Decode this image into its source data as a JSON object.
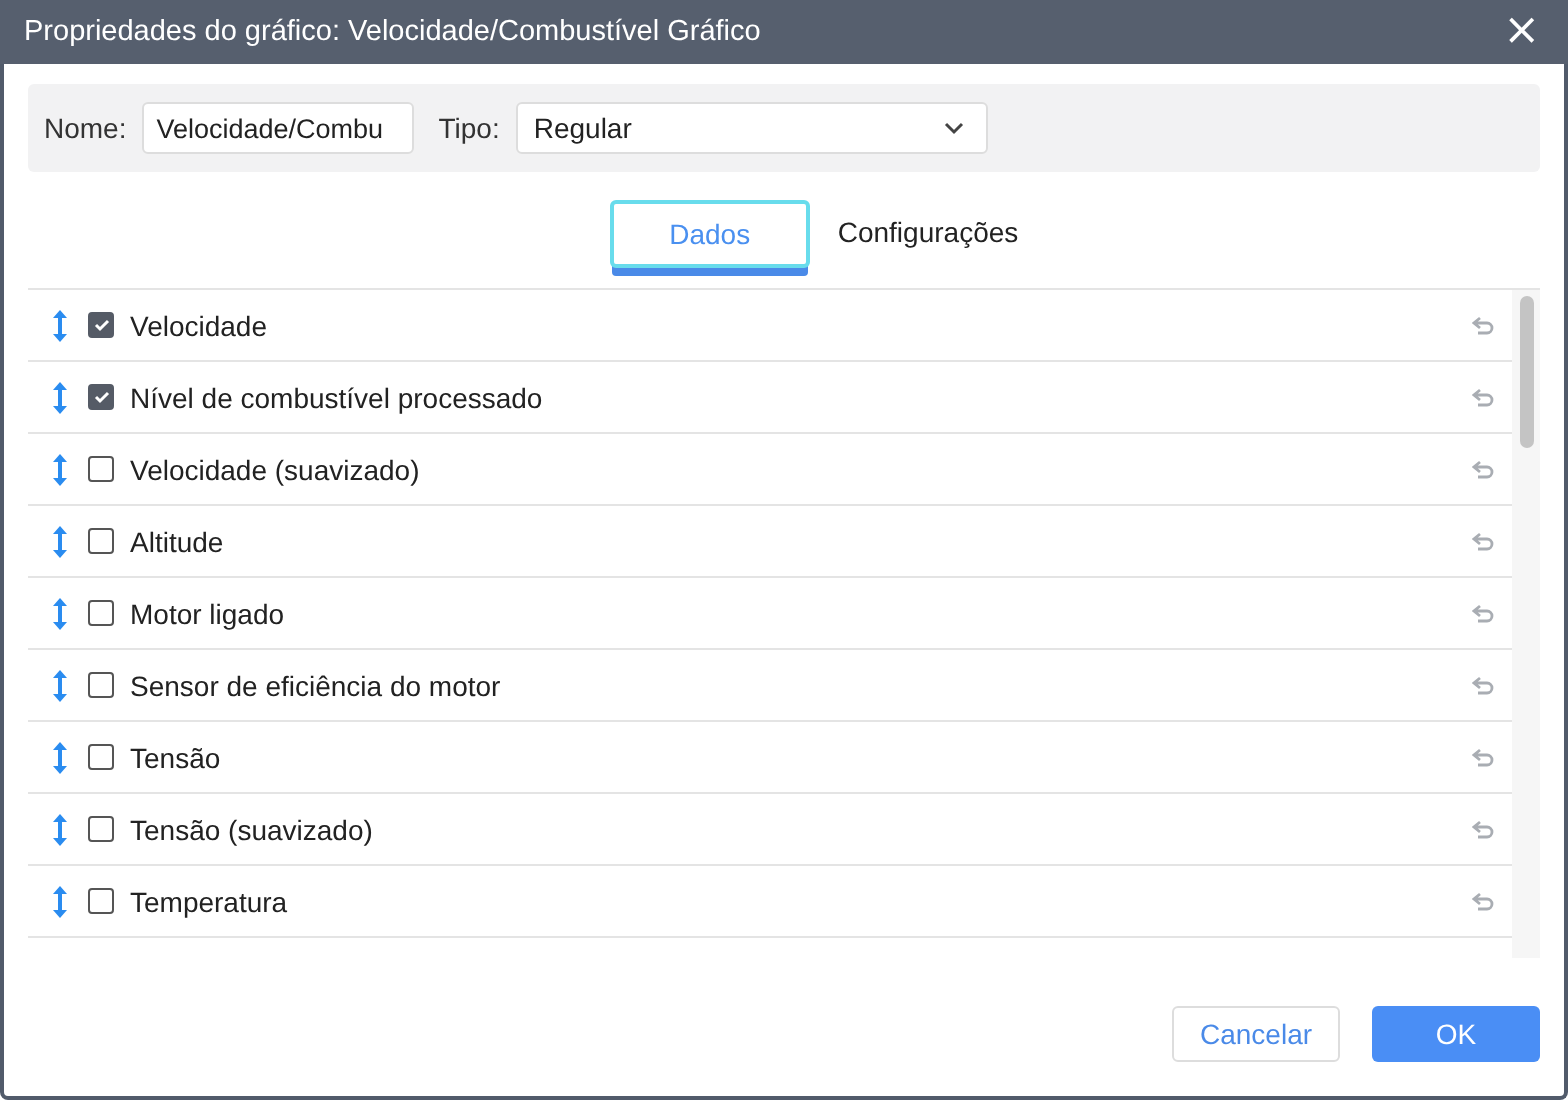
{
  "window": {
    "title": "Propriedades do gráfico: Velocidade/Combustível Gráfico",
    "close": "×"
  },
  "form": {
    "name_label": "Nome:",
    "name_value": "Velocidade/Combu",
    "type_label": "Tipo:",
    "type_value": "Regular"
  },
  "tabs": [
    {
      "label": "Dados",
      "selected": true
    },
    {
      "label": "Configurações",
      "selected": false
    }
  ],
  "items": [
    {
      "label": "Velocidade",
      "checked": true
    },
    {
      "label": "Nível de combustível processado",
      "checked": true
    },
    {
      "label": "Velocidade (suavizado)",
      "checked": false
    },
    {
      "label": "Altitude",
      "checked": false
    },
    {
      "label": "Motor ligado",
      "checked": false
    },
    {
      "label": "Sensor de eficiência do motor",
      "checked": false
    },
    {
      "label": "Tensão",
      "checked": false
    },
    {
      "label": "Tensão (suavizado)",
      "checked": false
    },
    {
      "label": "Temperatura",
      "checked": false
    }
  ],
  "buttons": [
    {
      "label": "Cancelar",
      "kind": "secondary"
    },
    {
      "label": "OK",
      "kind": "primary"
    }
  ]
}
